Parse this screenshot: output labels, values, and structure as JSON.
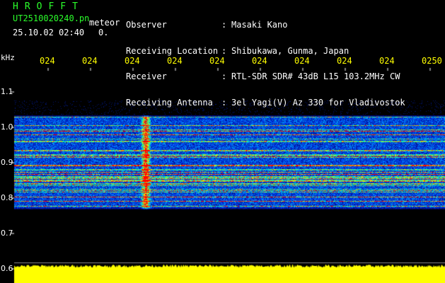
{
  "header": {
    "brand": "HROFFT",
    "file_name": "UT2510020240.pn",
    "mode": "meteor",
    "timestamp": "25.10.02 02:40",
    "count": "0.",
    "info": [
      {
        "label": "Observer",
        "value": "Masaki Kano"
      },
      {
        "label": "Receiving Location",
        "value": "Shibukawa, Gunma, Japan"
      },
      {
        "label": "Receiver",
        "value": "RTL-SDR SDR# 43dB L15 103.2MHz CW"
      },
      {
        "label": "Receiving Antenna",
        "value": "3el Yagi(V) Az 330 for Vladivostok"
      }
    ]
  },
  "colors": {
    "header_green": "#2bff2b",
    "time_label_yellow": "#ffff00",
    "axis_label_white": "#ffffff",
    "spectrum_fill_yellow": "#ffff00"
  },
  "chart_data": {
    "type": "heatmap",
    "title": "",
    "ylabel": "kHz",
    "xlabel": "",
    "x_ticks": [
      "024",
      "024",
      "024",
      "024",
      "024",
      "024",
      "024",
      "024",
      "024",
      "0250"
    ],
    "y_ticks": [
      1.1,
      1.0,
      0.9,
      0.8,
      0.7,
      0.6
    ],
    "ylim": [
      0.58,
      1.17
    ],
    "band_khz": [
      0.77,
      1.035
    ],
    "meteor_echo": {
      "time_fraction": 0.305,
      "khz_range": [
        0.78,
        1.035
      ]
    },
    "spectrum_line_khz": 0.6
  }
}
